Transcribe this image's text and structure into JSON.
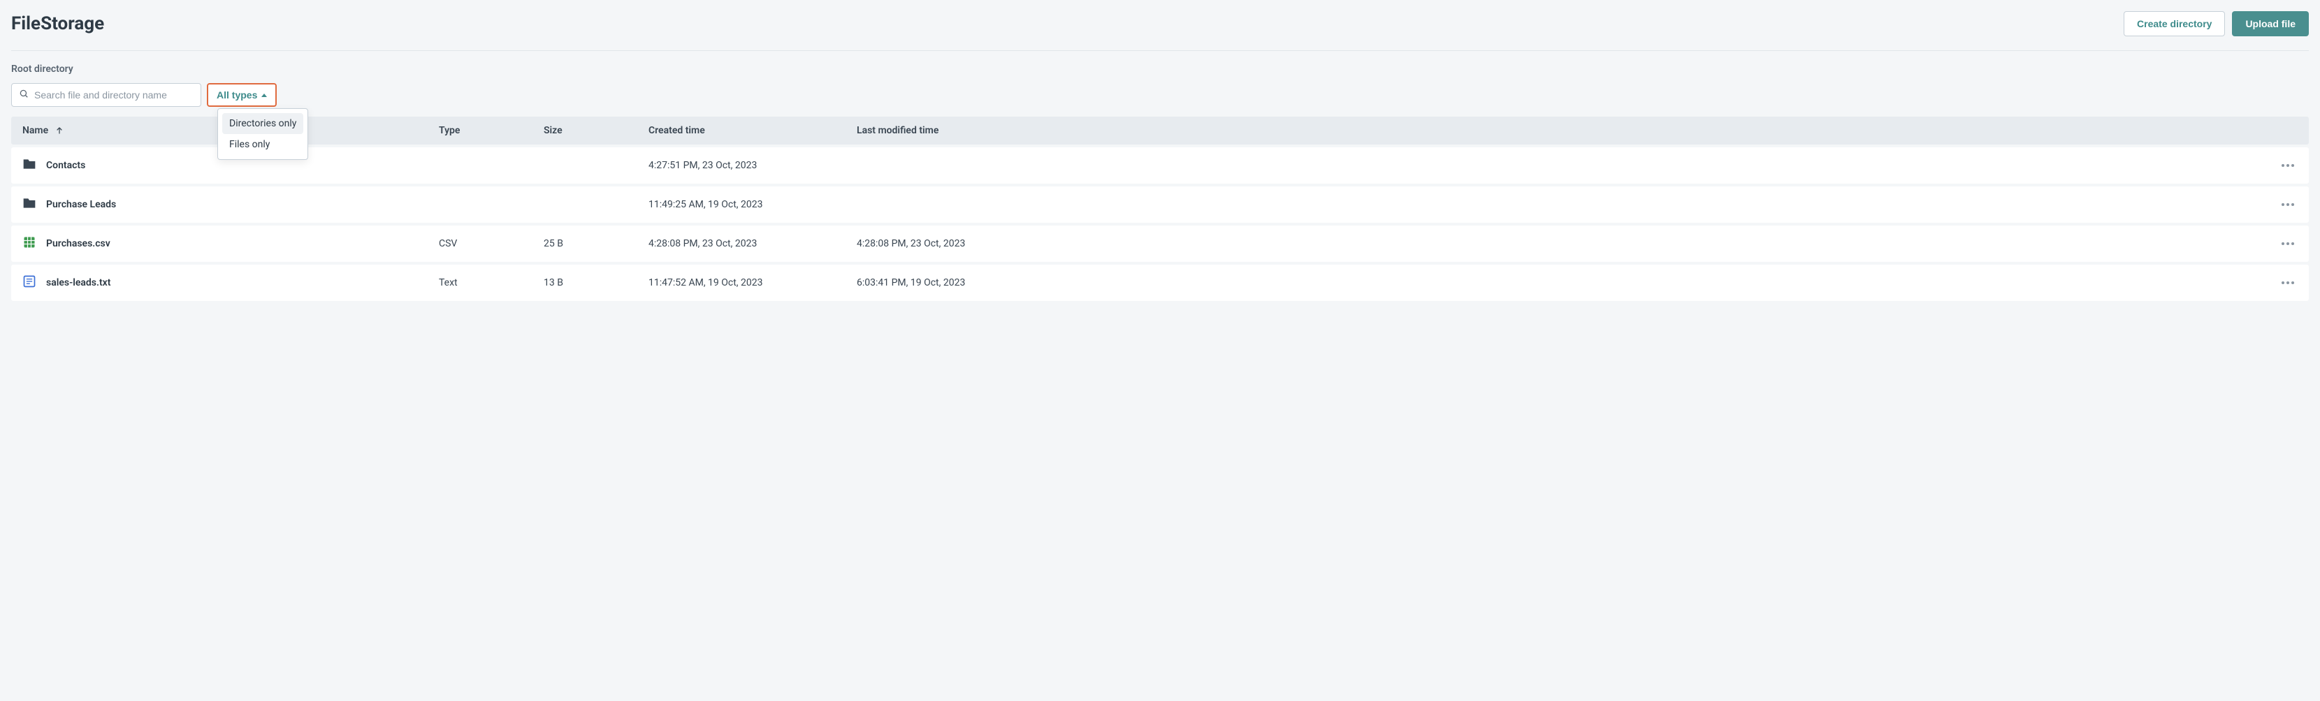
{
  "header": {
    "title": "FileStorage",
    "create_directory_label": "Create directory",
    "upload_file_label": "Upload file"
  },
  "breadcrumb": {
    "label": "Root directory"
  },
  "search": {
    "placeholder": "Search file and directory name"
  },
  "filter": {
    "label": "All types",
    "options": [
      {
        "label": "Directories only",
        "selected": true
      },
      {
        "label": "Files only",
        "selected": false
      }
    ]
  },
  "columns": {
    "name": "Name",
    "type": "Type",
    "size": "Size",
    "created": "Created time",
    "modified": "Last modified time"
  },
  "rows": [
    {
      "icon": "folder",
      "name": "Contacts",
      "type": "",
      "size": "",
      "created": "4:27:51 PM, 23 Oct, 2023",
      "modified": ""
    },
    {
      "icon": "folder",
      "name": "Purchase Leads",
      "type": "",
      "size": "",
      "created": "11:49:25 AM, 19 Oct, 2023",
      "modified": ""
    },
    {
      "icon": "csv",
      "name": "Purchases.csv",
      "type": "CSV",
      "size": "25 B",
      "created": "4:28:08 PM, 23 Oct, 2023",
      "modified": "4:28:08 PM, 23 Oct, 2023"
    },
    {
      "icon": "txt",
      "name": "sales-leads.txt",
      "type": "Text",
      "size": "13 B",
      "created": "11:47:52 AM, 19 Oct, 2023",
      "modified": "6:03:41 PM, 19 Oct, 2023"
    }
  ]
}
